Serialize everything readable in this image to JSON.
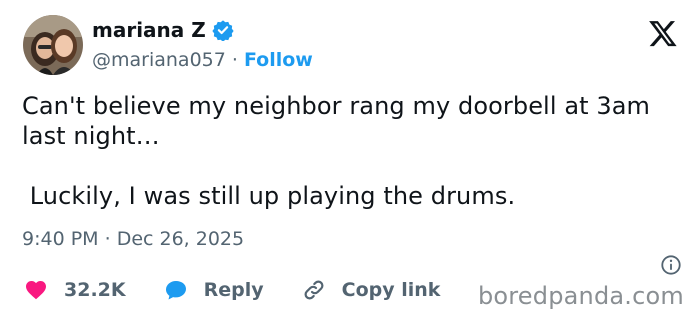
{
  "author": {
    "display_name": "mariana Z",
    "handle": "@mariana057",
    "separator": " · ",
    "follow_label": "Follow"
  },
  "tweet": {
    "line1": "Can't believe my neighbor rang my doorbell at 3am last night…",
    "line2": " Luckily, I was still up playing the drums.",
    "time": "9:40 PM",
    "meta_separator": " · ",
    "date": "Dec 26, 2025"
  },
  "actions": {
    "likes": "32.2K",
    "reply_label": "Reply",
    "copy_link_label": "Copy link"
  },
  "watermark": "boredpanda.com",
  "colors": {
    "accent": "#1d9bf0",
    "like": "#f91880",
    "muted": "#536471",
    "text": "#0f1419"
  },
  "icons": {
    "verified": "verified-badge-icon",
    "logo": "x-logo-icon",
    "info": "info-icon",
    "like": "heart-icon",
    "reply": "speech-bubble-icon",
    "copy": "link-icon"
  }
}
